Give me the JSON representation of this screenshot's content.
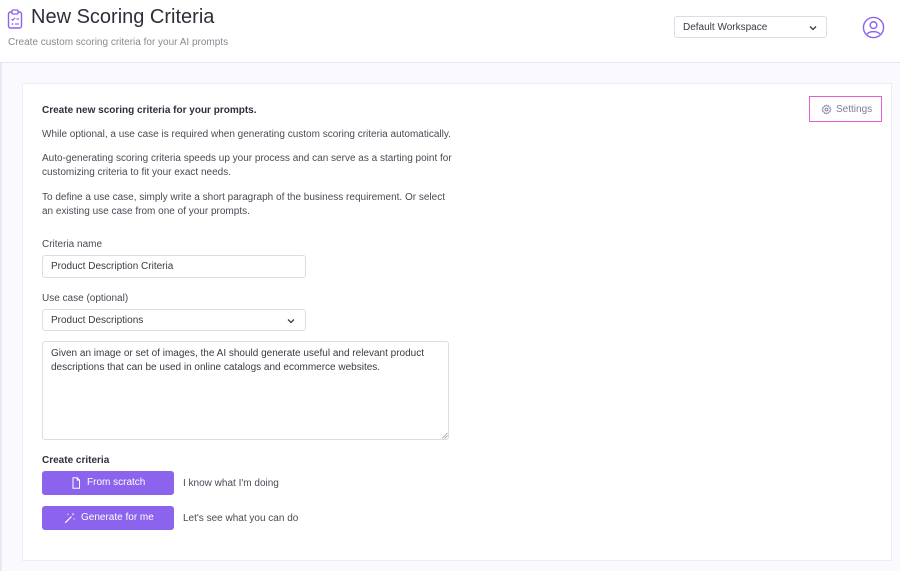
{
  "header": {
    "title": "New Scoring Criteria",
    "subtitle": "Create custom scoring criteria for your AI prompts",
    "title_icon": "clipboard-list-icon",
    "workspace_select": "Default Workspace",
    "avatar_icon": "user-circle-icon"
  },
  "settings": {
    "label": "Settings",
    "icon": "gear-icon"
  },
  "intro": {
    "heading": "Create new scoring criteria for your prompts.",
    "p1": "While optional, a use case is required when generating custom scoring criteria automatically.",
    "p2_line1": "Auto-generating scoring criteria speeds up your process and can serve as a starting point for",
    "p2_line2": "customizing criteria to fit your exact needs.",
    "p3_line1": "To define a use case, simply write a short paragraph of the business requirement. Or select",
    "p3_line2": "an existing use case from one of your prompts."
  },
  "form": {
    "criteria_name_label": "Criteria name",
    "criteria_name_value": "Product Description Criteria",
    "use_case_label": "Use case (optional)",
    "use_case_selected": "Product Descriptions",
    "use_case_text": "Given an image or set of images, the AI should generate useful and relevant product descriptions that can be used in online catalogs and ecommerce websites."
  },
  "create": {
    "label": "Create criteria",
    "from_scratch_label": "From scratch",
    "from_scratch_hint": "I know what I'm doing",
    "generate_label": "Generate for me",
    "generate_hint": "Let's see what you can do"
  },
  "colors": {
    "accent": "#8b63ec",
    "settings_border": "#e45fd1",
    "page_bg": "#faf9fd"
  }
}
